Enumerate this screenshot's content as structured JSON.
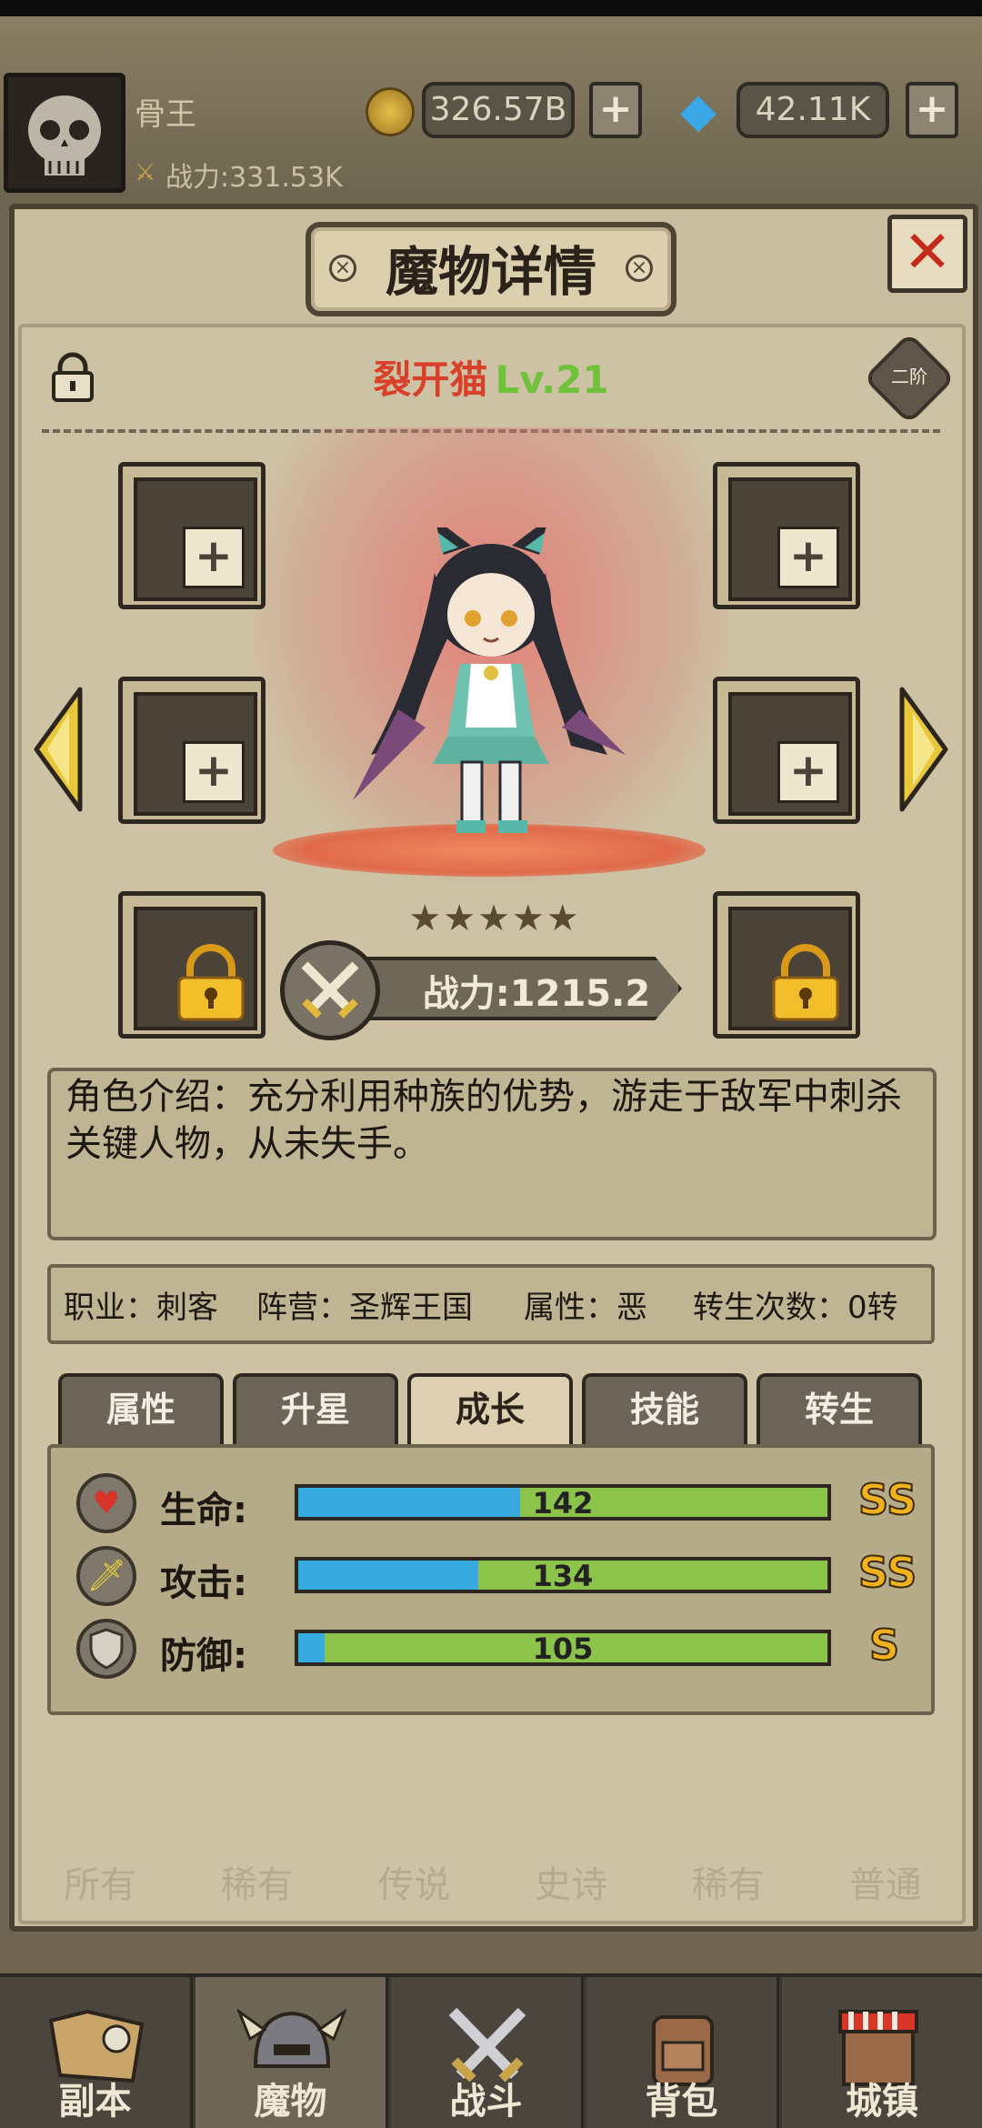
{
  "header": {
    "player_name": "骨王",
    "player_power": "战力:331.53K",
    "gold": "326.57B",
    "gems": "42.11K",
    "plus_label": "+"
  },
  "dialog": {
    "title": "魔物详情",
    "close_label": "✕",
    "monster_name": "裂开猫",
    "monster_level": "Lv.21",
    "rank": "二阶",
    "slot_plus": "+",
    "stars": "★★★★★",
    "power": "战力:1215.2",
    "description": "角色介绍：充分利用种族的优势，游走于敌军中刺杀关键人物，从未失手。",
    "info": {
      "job": "职业：刺客",
      "faction": "阵营：圣辉王国",
      "alignment": "属性：恶",
      "rebirth": "转生次数：0转"
    },
    "tabs": [
      "属性",
      "升星",
      "成长",
      "技能",
      "转生"
    ],
    "active_tab": "成长",
    "stats": [
      {
        "label": "生命:",
        "value": "142",
        "fill": 0.42,
        "grade": "SS",
        "icon": "heart-icon"
      },
      {
        "label": "攻击:",
        "value": "134",
        "fill": 0.34,
        "grade": "SS",
        "icon": "sword-icon"
      },
      {
        "label": "防御:",
        "value": "105",
        "fill": 0.05,
        "grade": "S",
        "icon": "shield-icon"
      }
    ],
    "faded_filters": [
      "所有",
      "稀有",
      "传说",
      "史诗",
      "稀有",
      "普通"
    ]
  },
  "nav": {
    "items": [
      "副本",
      "魔物",
      "战斗",
      "背包",
      "城镇"
    ],
    "active": "魔物"
  },
  "colors": {
    "hp_bar": "#37a9de",
    "growth_bar": "#8cc34a",
    "grade": "#f2b21d",
    "name": "#d8402a",
    "level": "#6fc23a"
  }
}
